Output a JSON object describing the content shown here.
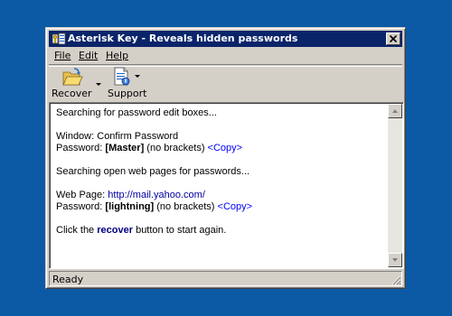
{
  "window": {
    "title": "Asterisk Key - Reveals hidden passwords"
  },
  "menu": {
    "file": "File",
    "edit": "Edit",
    "help": "Help"
  },
  "toolbar": {
    "recover_label": "Recover",
    "support_label": "Support"
  },
  "log": {
    "line1": "Searching for password edit boxes...",
    "window_prefix": "Window: ",
    "window_name": "Confirm Password",
    "pw1_prefix": "Password: ",
    "pw1_open": "[",
    "pw1_value": "Master",
    "pw1_close": "]",
    "pw1_note": " (no brackets) ",
    "pw1_copy": "<Copy>",
    "line2": "Searching open web pages for passwords...",
    "webpage_prefix": "Web Page: ",
    "webpage_url": "http://mail.yahoo.com/",
    "pw2_prefix": "Password: ",
    "pw2_open": "[",
    "pw2_value": "lightning",
    "pw2_close": "]",
    "pw2_note": " (no brackets) ",
    "pw2_copy": "<Copy>",
    "click_prefix": "Click the ",
    "click_keyword": "recover",
    "click_suffix": " button to start again."
  },
  "statusbar": {
    "text": "Ready"
  },
  "icons": {
    "app": "key-icon",
    "recover": "folder-open-icon",
    "support": "document-icon"
  },
  "colors": {
    "desktop": "#0c5aa5",
    "titlebar": "#0a246a",
    "link": "#0000a0",
    "copy": "#0000ff"
  }
}
